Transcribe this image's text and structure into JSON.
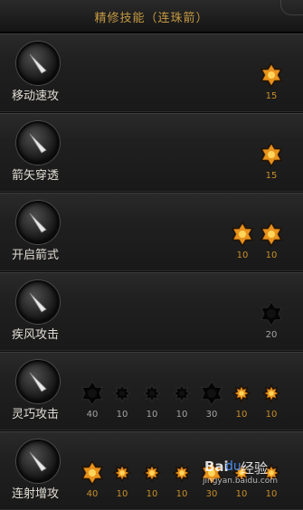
{
  "title": "精修技能（连珠箭）",
  "skills": [
    {
      "name": "移动速攻",
      "slots": [
        {
          "value": "15",
          "type": "orange-large"
        }
      ]
    },
    {
      "name": "箭矢穿透",
      "slots": [
        {
          "value": "15",
          "type": "orange-large"
        }
      ]
    },
    {
      "name": "开启箭式",
      "slots": [
        {
          "value": "10",
          "type": "orange-large"
        },
        {
          "value": "10",
          "type": "orange-large"
        }
      ]
    },
    {
      "name": "疾风攻击",
      "slots": [
        {
          "value": "20",
          "type": "dark-large"
        }
      ]
    },
    {
      "name": "灵巧攻击",
      "slots": [
        {
          "value": "40",
          "type": "dark-large"
        },
        {
          "value": "10",
          "type": "dark-small"
        },
        {
          "value": "10",
          "type": "dark-small"
        },
        {
          "value": "10",
          "type": "dark-small"
        },
        {
          "value": "30",
          "type": "dark-large"
        },
        {
          "value": "10",
          "type": "orange-small"
        },
        {
          "value": "10",
          "type": "orange-small"
        }
      ]
    },
    {
      "name": "连射增攻",
      "slots": [
        {
          "value": "40",
          "type": "orange-large"
        },
        {
          "value": "10",
          "type": "orange-small"
        },
        {
          "value": "10",
          "type": "orange-small"
        },
        {
          "value": "10",
          "type": "orange-small"
        },
        {
          "value": "30",
          "type": "orange-large"
        },
        {
          "value": "10",
          "type": "orange-small"
        },
        {
          "value": "10",
          "type": "orange-small"
        }
      ]
    }
  ],
  "watermark": {
    "brand": "Bai",
    "paw": "du",
    "suffix": "经验",
    "url": "jingyan.baidu.com"
  },
  "colors": {
    "title": "#c69a43",
    "value_active": "#c88f2a",
    "value_inactive": "#a4a4a4"
  }
}
